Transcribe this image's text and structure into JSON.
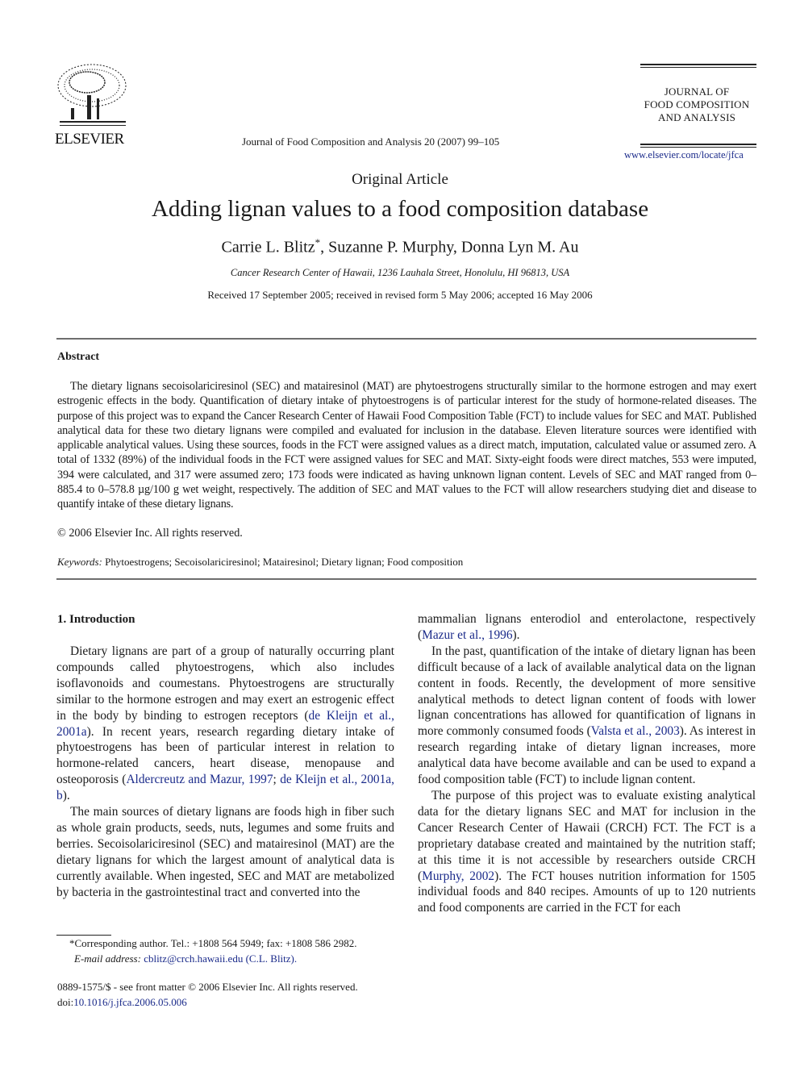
{
  "header": {
    "publisher_logo": "elsevier-tree-logo",
    "publisher_name": "ELSEVIER",
    "citation": "Journal of Food Composition and Analysis 20 (2007) 99–105",
    "journal_name_lines": [
      "JOURNAL OF",
      "FOOD COMPOSITION",
      "AND ANALYSIS"
    ],
    "journal_url": "www.elsevier.com/locate/jfca"
  },
  "article": {
    "type": "Original Article",
    "title": "Adding lignan values to a food composition database",
    "authors": [
      {
        "name": "Carrie L. Blitz",
        "marker": "*"
      },
      {
        "name": "Suzanne P. Murphy",
        "marker": ""
      },
      {
        "name": "Donna Lyn M. Au",
        "marker": ""
      }
    ],
    "affiliation": "Cancer Research Center of Hawaii, 1236 Lauhala Street, Honolulu, HI 96813, USA",
    "dates": "Received 17 September 2005; received in revised form 5 May 2006; accepted 16 May 2006"
  },
  "abstract": {
    "heading": "Abstract",
    "text": "The dietary lignans secoisolariciresinol (SEC) and matairesinol (MAT) are phytoestrogens structurally similar to the hormone estrogen and may exert estrogenic effects in the body. Quantification of dietary intake of phytoestrogens is of particular interest for the study of hormone-related diseases. The purpose of this project was to expand the Cancer Research Center of Hawaii Food Composition Table (FCT) to include values for SEC and MAT. Published analytical data for these two dietary lignans were compiled and evaluated for inclusion in the database. Eleven literature sources were identified with applicable analytical values. Using these sources, foods in the FCT were assigned values as a direct match, imputation, calculated value or assumed zero. A total of 1332 (89%) of the individual foods in the FCT were assigned values for SEC and MAT. Sixty-eight foods were direct matches, 553 were imputed, 394 were calculated, and 317 were assumed zero; 173 foods were indicated as having unknown lignan content. Levels of SEC and MAT ranged from 0–885.4 to 0–578.8 µg/100 g wet weight, respectively. The addition of SEC and MAT values to the FCT will allow researchers studying diet and disease to quantify intake of these dietary lignans.",
    "copyright": "© 2006 Elsevier Inc. All rights reserved.",
    "keywords_label": "Keywords:",
    "keywords": "Phytoestrogens; Secoisolariciresinol; Matairesinol; Dietary lignan; Food composition"
  },
  "body": {
    "section_heading": "1.  Introduction",
    "left": {
      "p1_a": "Dietary lignans are part of a group of naturally occurring plant compounds called phytoestrogens, which also includes isoflavonoids and coumestans. Phytoestrogens are structurally similar to the hormone estrogen and may exert an estrogenic effect in the body by binding to estrogen receptors (",
      "p1_link1": "de Kleijn et al., 2001a",
      "p1_b": "). In recent years, research regarding dietary intake of phytoestrogens has been of particular interest in relation to hormone-related cancers, heart disease, menopause and osteoporosis (",
      "p1_link2": "Aldercreutz and Mazur, 1997",
      "p1_sep": "; ",
      "p1_link3": "de Kleijn et al., 2001a, b",
      "p1_c": ").",
      "p2": "The main sources of dietary lignans are foods high in fiber such as whole grain products, seeds, nuts, legumes and some fruits and berries. Secoisolariciresinol (SEC) and matairesinol (MAT) are the dietary lignans for which the largest amount of analytical data is currently available. When ingested, SEC and MAT are metabolized by bacteria in the gastrointestinal tract and converted into the"
    },
    "right": {
      "p0_a": "mammalian lignans enterodiol and enterolactone, respectively (",
      "p0_link": "Mazur et al., 1996",
      "p0_b": ").",
      "p1_a": "In the past, quantification of the intake of dietary lignan has been difficult because of a lack of available analytical data on the lignan content in foods. Recently, the development of more sensitive analytical methods to detect lignan content of foods with lower lignan concentrations has allowed for quantification of lignans in more commonly consumed foods (",
      "p1_link": "Valsta et al., 2003",
      "p1_b": "). As interest in research regarding intake of dietary lignan increases, more analytical data have become available and can be used to expand a food composition table (FCT) to include lignan content.",
      "p2_a": "The purpose of this project was to evaluate existing analytical data for the dietary lignans SEC and MAT for inclusion in the Cancer Research Center of Hawaii (CRCH) FCT. The FCT is a proprietary database created and maintained by the nutrition staff; at this time it is not accessible by researchers outside CRCH (",
      "p2_link": "Murphy, 2002",
      "p2_b": "). The FCT houses nutrition information for 1505 individual foods and 840 recipes. Amounts of up to 120 nutrients and food components are carried in the FCT for each"
    }
  },
  "footnotes": {
    "corresponding": "*Corresponding author. Tel.: +1808 564 5949; fax: +1808 586 2982.",
    "email_label": "E-mail address:",
    "email": "cblitz@crch.hawaii.edu",
    "email_suffix": " (C.L. Blitz).",
    "issn": "0889-1575/$ - see front matter © 2006 Elsevier Inc. All rights reserved.",
    "doi_label": "doi:",
    "doi": "10.1016/j.jfca.2006.05.006"
  },
  "colors": {
    "link": "#1a2a8a",
    "text": "#1a1a1a",
    "rule": "#6e6e6e"
  }
}
